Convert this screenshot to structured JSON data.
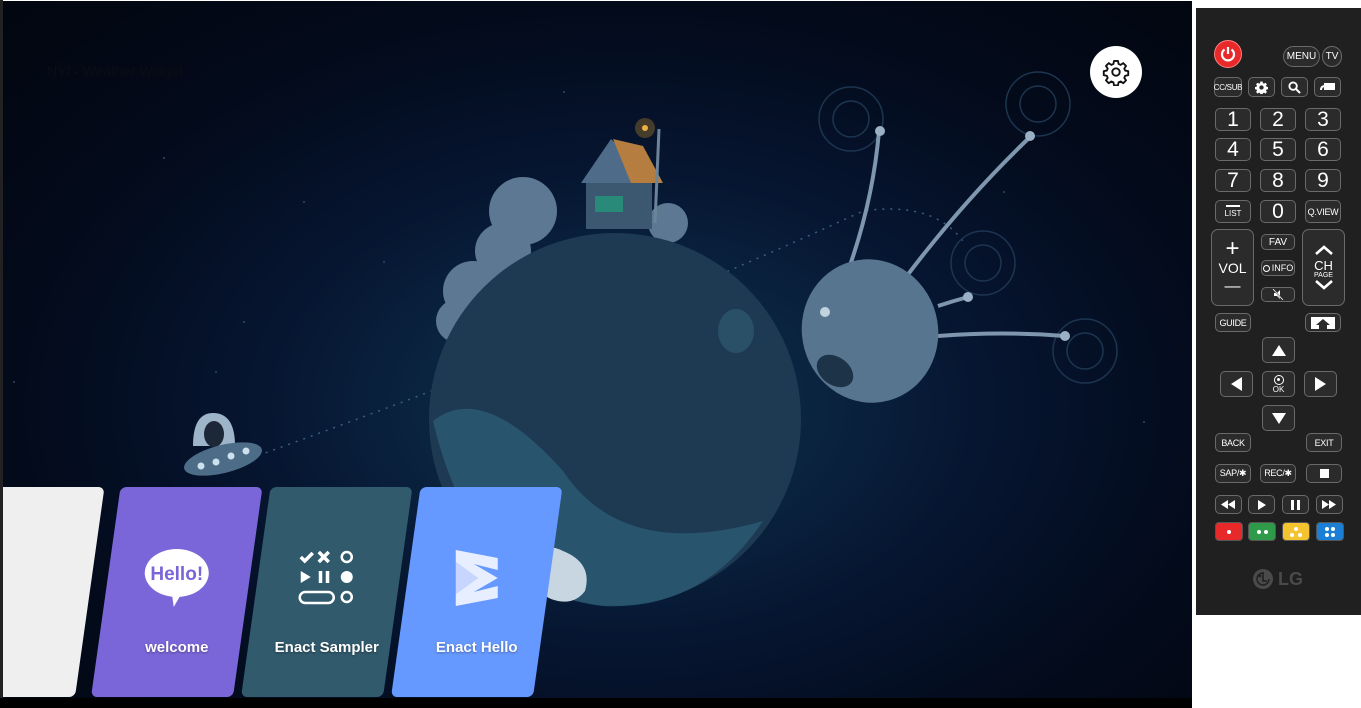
{
  "tv": {
    "widget_title": "NYI - Weather Widget",
    "settings_icon": "gear-icon",
    "apps": [
      {
        "label": "",
        "color": "#efefef",
        "icon": "blank"
      },
      {
        "label": "welcome",
        "color": "#7a66d8",
        "icon": "hello-bubble-icon",
        "icon_text": "Hello!"
      },
      {
        "label": "Enact Sampler",
        "color": "#315a6c",
        "icon": "sampler-icon"
      },
      {
        "label": "Enact Hello",
        "color": "#6699ff",
        "icon": "enact-logo-icon"
      }
    ]
  },
  "remote": {
    "power_icon": "power-icon",
    "menu": "MENU",
    "tv": "TV",
    "cc_sub": "CC/SUB",
    "settings_icon": "gear-icon",
    "search_icon": "search-icon",
    "input_icon": "input-icon",
    "numbers": [
      "1",
      "2",
      "3",
      "4",
      "5",
      "6",
      "7",
      "8",
      "9"
    ],
    "list": "LIST",
    "zero": "0",
    "qview": "Q.VIEW",
    "vol_plus": "+",
    "vol": "VOL",
    "vol_minus": "—",
    "fav": "FAV",
    "info": "INFO",
    "mute_icon": "mute-icon",
    "ch": "CH",
    "page": "PAGE",
    "guide": "GUIDE",
    "home_icon": "home-icon",
    "ok": "OK",
    "back": "BACK",
    "exit": "EXIT",
    "sap": "SAP/✱",
    "rec": "REC/✱",
    "stop_icon": "stop-icon",
    "rewind_icon": "rewind-icon",
    "play_icon": "play-icon",
    "pause_icon": "pause-icon",
    "fastforward_icon": "fast-forward-icon",
    "color_buttons": [
      {
        "name": "red",
        "color": "#e8292a",
        "dots": 1
      },
      {
        "name": "green",
        "color": "#2e9a4a",
        "dots": 2
      },
      {
        "name": "yellow",
        "color": "#f4c430",
        "dots": 3
      },
      {
        "name": "blue",
        "color": "#1b7fd6",
        "dots": 4
      }
    ],
    "brand": "LG"
  }
}
